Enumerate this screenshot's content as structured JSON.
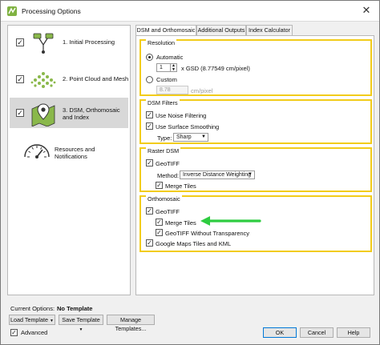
{
  "window": {
    "title": "Processing Options"
  },
  "sidebar": {
    "items": [
      {
        "label": "1. Initial Processing",
        "checked": true,
        "icon": "initial-processing-icon"
      },
      {
        "label": "2. Point Cloud and Mesh",
        "checked": true,
        "icon": "point-cloud-icon"
      },
      {
        "label": "3. DSM, Orthomosaic and Index",
        "checked": true,
        "icon": "map-pin-icon",
        "selected": true
      },
      {
        "label": "Resources and Notifications",
        "checked": false,
        "icon": "gauge-icon"
      }
    ]
  },
  "tabs": [
    {
      "label": "DSM and Orthomosaic",
      "active": true
    },
    {
      "label": "Additional Outputs",
      "active": false
    },
    {
      "label": "Index Calculator",
      "active": false
    }
  ],
  "resolution": {
    "title": "Resolution",
    "automatic_label": "Automatic",
    "gsd_value": "1",
    "gsd_text": "x GSD (8.77549 cm/pixel)",
    "custom_label": "Custom",
    "custom_value": "8.78",
    "custom_unit": "cm/pixel"
  },
  "dsm_filters": {
    "title": "DSM Filters",
    "noise_label": "Use Noise Filtering",
    "smoothing_label": "Use Surface Smoothing",
    "type_label": "Type:",
    "type_value": "Sharp"
  },
  "raster_dsm": {
    "title": "Raster DSM",
    "geotiff_label": "GeoTIFF",
    "method_label": "Method:",
    "method_value": "Inverse Distance Weighting",
    "merge_label": "Merge Tiles"
  },
  "orthomosaic": {
    "title": "Orthomosaic",
    "geotiff_label": "GeoTIFF",
    "merge_label": "Merge Tiles",
    "no_transparency_label": "GeoTIFF Without Transparency",
    "google_maps_label": "Google Maps Tiles and KML"
  },
  "bottom": {
    "current_options_label": "Current Options:",
    "current_options_value": "No Template",
    "load_template": "Load Template",
    "save_template": "Save Template",
    "manage_templates": "Manage Templates...",
    "advanced_label": "Advanced",
    "ok": "OK",
    "cancel": "Cancel",
    "help": "Help"
  },
  "colors": {
    "highlight_border": "#f2cc1b",
    "arrow": "#2ecc40",
    "accent": "#0078d7"
  }
}
